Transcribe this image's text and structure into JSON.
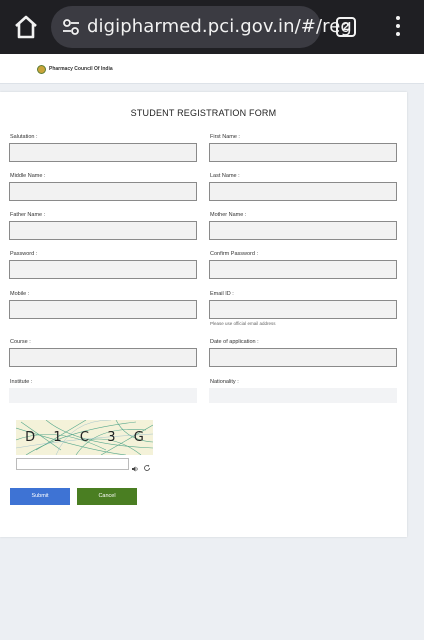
{
  "browser": {
    "url": "digipharmed.pci.gov.in/#/reg",
    "tab_count": "2"
  },
  "site": {
    "org_name": "Pharmacy Council Of India"
  },
  "form": {
    "title": "STUDENT REGISTRATION FORM",
    "fields": {
      "salutation": {
        "label": "Salutation :",
        "value": ""
      },
      "first_name": {
        "label": "First Name :",
        "value": ""
      },
      "middle_name": {
        "label": "Middle Name :",
        "value": ""
      },
      "last_name": {
        "label": "Last Name :",
        "value": ""
      },
      "father_name": {
        "label": "Father Name :",
        "value": ""
      },
      "mother_name": {
        "label": "Mother Name :",
        "value": ""
      },
      "password": {
        "label": "Password :",
        "value": ""
      },
      "confirm_password": {
        "label": "Confirm Password :",
        "value": ""
      },
      "mobile": {
        "label": "Mobile :",
        "value": ""
      },
      "email": {
        "label": "Email ID :",
        "value": "",
        "helper": "Please use official email address"
      },
      "course": {
        "label": "Course :",
        "value": ""
      },
      "date_of_application": {
        "label": "Date of application :",
        "value": ""
      },
      "institute": {
        "label": "Institute :",
        "value": ""
      },
      "nationality": {
        "label": "Nationality :",
        "value": ""
      }
    },
    "captcha": {
      "characters": [
        "D",
        "1",
        "C",
        "3",
        "G"
      ],
      "input_value": ""
    },
    "submit_label": "Submit",
    "cancel_label": "Cancel"
  },
  "colors": {
    "submit_button": "#3e73d4",
    "cancel_button": "#4a7e22",
    "browser_bar": "#1f1f23"
  },
  "icons": {
    "home": "home-icon",
    "site_info": "tune-icon",
    "tabs": "tabs-icon",
    "menu": "more-vert-icon",
    "audio": "speaker-icon",
    "refresh": "refresh-icon"
  }
}
